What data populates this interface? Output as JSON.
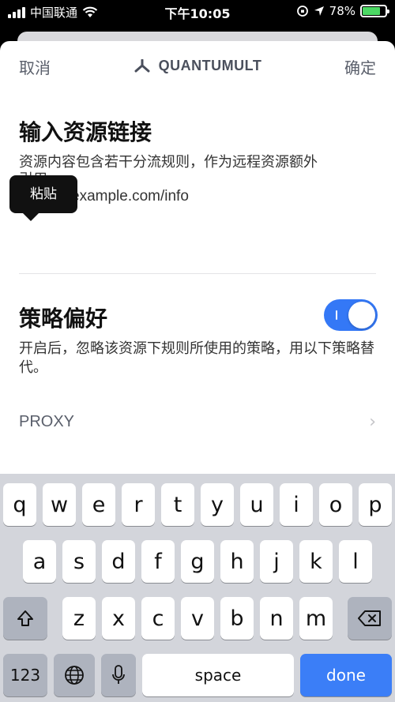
{
  "status": {
    "carrier": "中国联通",
    "time": "下午10:05",
    "battery": "78%",
    "battery_level": 0.78
  },
  "nav": {
    "cancel_label": "取消",
    "title": "QUANTUMULT",
    "done_label": "确定"
  },
  "resource": {
    "heading": "输入资源链接",
    "description": "资源内容包含若干分流规则，作为远程资源额外",
    "description_cut": "引用",
    "link_value": "example.com/info",
    "tooltip": "粘贴"
  },
  "policy": {
    "heading": "策略偏好",
    "description": "开启后，忽略该资源下规则所使用的策略，用以下策略替代。",
    "toggle_on": true,
    "proxy_label": "PROXY"
  },
  "keyboard": {
    "row1": [
      "q",
      "w",
      "e",
      "r",
      "t",
      "y",
      "u",
      "i",
      "o",
      "p"
    ],
    "row2": [
      "a",
      "s",
      "d",
      "f",
      "g",
      "h",
      "j",
      "k",
      "l"
    ],
    "row3": [
      "z",
      "x",
      "c",
      "v",
      "b",
      "n",
      "m"
    ],
    "num_label": "123",
    "space_label": "space",
    "done_label": "done"
  }
}
